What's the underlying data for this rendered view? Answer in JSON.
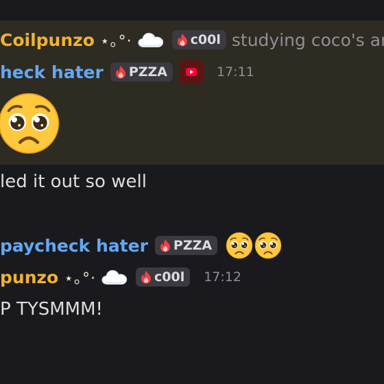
{
  "messages": {
    "reply1": {
      "author": "Coilpunzo",
      "author_deco": "⋆｡°·",
      "tag": "c00l",
      "reply_text": "studying coco's ar"
    },
    "main1": {
      "author": "heck hater",
      "tag": "PZZA",
      "time": "17:11"
    },
    "text1": "led it out so well",
    "reply2": {
      "author": "paycheck hater",
      "tag": "PZZA"
    },
    "main2": {
      "author": "punzo",
      "author_deco": "⋆｡°·",
      "tag": "c00l",
      "time": "17:12"
    },
    "text2": "P TYSMMM!"
  },
  "colors": {
    "gold_name": "#f0b232",
    "blue_name": "#62a8f4",
    "highlight_bg": "#2e2b22",
    "page_bg": "#1a1a1e"
  },
  "icons": [
    "cloud-icon",
    "fire-icon",
    "youtube-icon",
    "pleading-face-emoji"
  ]
}
